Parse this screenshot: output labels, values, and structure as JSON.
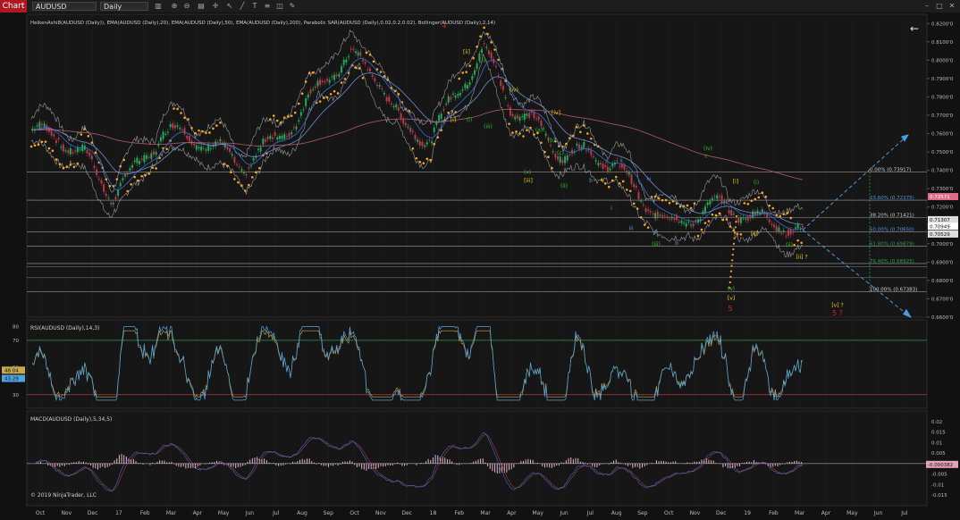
{
  "toolbar": {
    "tab_label": "Chart",
    "instrument": "AUDUSD",
    "interval": "Daily",
    "window_buttons": [
      "–",
      "□",
      "✕"
    ]
  },
  "colors": {
    "background": "#111111",
    "candle_up": "#26a65b",
    "candle_down": "#b33a4a",
    "sar": "#f5a623",
    "ema20": "#3a6fcf",
    "ema200": "#b05a6a",
    "bollinger": "#cfcfcf",
    "rsi": "#4fa3e0",
    "rsi_signal": "#c8a84b",
    "macd_hist": "#e8b6c8",
    "wave_green": "#2dc52d",
    "wave_yellow": "#e6d200",
    "wave_red": "#e02020",
    "fib": "#4a9de0",
    "fib_green": "#2f9a4a"
  },
  "price_panel": {
    "indicators_label": "HeikenAshi8(AUDUSD (Daily)), EMA(AUDUSD (Daily),20), EMA(AUDUSD (Daily),50), EMA(AUDUSD (Daily),200), Parabolic SAR(AUDUSD (Daily),0.02,0.2,0.02), Bollinger(AUDUSD (Daily),2,14)",
    "fib_levels": [
      {
        "label": "0.00% (0.73917)",
        "color": "#cfcfcf"
      },
      {
        "label": "23.60% (0.72375)",
        "color": "#4a9de0"
      },
      {
        "label": "38.20% (0.71421)",
        "color": "#cfcfcf"
      },
      {
        "label": "50.00% (0.70650)",
        "color": "#4a9de0"
      },
      {
        "label": "61.80% (0.69879)",
        "color": "#2f9a4a"
      },
      {
        "label": "76.40% (0.68925)",
        "color": "#2f9a4a"
      },
      {
        "label": "100.00% (0.67383)",
        "color": "#cfcfcf"
      }
    ],
    "price_badges": [
      {
        "label": "0.72571",
        "bg": "#e06a8a",
        "fg": "#fff"
      },
      {
        "label": "0.71307",
        "bg": "#dddddd",
        "fg": "#111"
      },
      {
        "label": "0.70949",
        "bg": "#ffffff",
        "fg": "#111"
      },
      {
        "label": "0.70529",
        "bg": "#dddddd",
        "fg": "#111"
      }
    ],
    "wave_labels": [
      {
        "text": "4",
        "color": "#e02020"
      },
      {
        "text": "[ii]",
        "color": "#e6d200"
      },
      {
        "text": "(ii)",
        "color": "#2dc52d"
      },
      {
        "text": "[i]",
        "color": "#e6d200"
      },
      {
        "text": "(i)",
        "color": "#2dc52d"
      },
      {
        "text": "(iii)",
        "color": "#2dc52d"
      },
      {
        "text": "(iv)",
        "color": "#e6d200"
      },
      {
        "text": "[iv]",
        "color": "#e6d200"
      },
      {
        "text": "(a)",
        "color": "#2dc52d"
      },
      {
        "text": "(b)",
        "color": "#2dc52d"
      },
      {
        "text": "(c)",
        "color": "#2dc52d"
      },
      {
        "text": "(v)",
        "color": "#2dc52d"
      },
      {
        "text": "[iii]",
        "color": "#e6d200"
      },
      {
        "text": "(ii)",
        "color": "#2dc52d"
      },
      {
        "text": "a",
        "color": "#4a9de0"
      },
      {
        "text": "b",
        "color": "#4a9de0"
      },
      {
        "text": "c",
        "color": "#4a9de0"
      },
      {
        "text": "i",
        "color": "#4a9de0"
      },
      {
        "text": "ii",
        "color": "#4a9de0"
      },
      {
        "text": "iii",
        "color": "#4a9de0"
      },
      {
        "text": "iv",
        "color": "#4a9de0"
      },
      {
        "text": "v",
        "color": "#4a9de0"
      },
      {
        "text": "(iii)",
        "color": "#2dc52d"
      },
      {
        "text": "(iv)",
        "color": "#2dc52d"
      },
      {
        "text": "c",
        "color": "#2dc52d"
      },
      {
        "text": "b",
        "color": "#4a9de0"
      },
      {
        "text": "(v)",
        "color": "#2dc52d"
      },
      {
        "text": "[v]",
        "color": "#e6d200"
      },
      {
        "text": "5",
        "color": "#e02020"
      },
      {
        "text": "[i]",
        "color": "#e6d200"
      },
      {
        "text": "(i)",
        "color": "#2dc52d"
      },
      {
        "text": "[ii]",
        "color": "#e6d200"
      },
      {
        "text": "(ii)",
        "color": "#2dc52d"
      },
      {
        "text": "[ii] ?",
        "color": "#e6d200"
      },
      {
        "text": "[v] ?",
        "color": "#e6d200"
      },
      {
        "text": "5 ?",
        "color": "#e02020"
      }
    ]
  },
  "rsi_panel": {
    "label": "RSI(AUDUSD (Daily),14,3)",
    "ticks": [
      "80",
      "70",
      "50",
      "30"
    ],
    "badges": [
      "48.04",
      "43.29"
    ]
  },
  "macd_panel": {
    "label": "MACD(AUDUSD (Daily),5,34,5)",
    "ticks": [
      "0.02",
      "0.015",
      "0.01",
      "0.005",
      "0",
      "-0.005",
      "-0.01",
      "-0.015"
    ],
    "badge": "-0.000382",
    "copyright": "© 2019 NinjaTrader, LLC"
  },
  "x_axis": [
    "Oct",
    "Nov",
    "Dec",
    "17",
    "Feb",
    "Mar",
    "Apr",
    "May",
    "Jun",
    "Jul",
    "Aug",
    "Sep",
    "Oct",
    "Nov",
    "Dec",
    "18",
    "Feb",
    "Mar",
    "Apr",
    "May",
    "Jun",
    "Jul",
    "Aug",
    "Sep",
    "Oct",
    "Nov",
    "Dec",
    "19",
    "Feb",
    "Mar",
    "Apr",
    "May",
    "Jun",
    "Jul",
    "Aug"
  ],
  "chart_data": {
    "type": "line",
    "instrument": "AUDUSD",
    "interval": "Daily",
    "y_axis_ticks": [
      "0.8200'0",
      "0.8100'0",
      "0.8000'0",
      "0.7900'0",
      "0.7800'0",
      "0.7700'0",
      "0.7600'0",
      "0.7500'0",
      "0.7400'0",
      "0.7300'0",
      "0.7200'0",
      "0.7100'0",
      "0.7000'0",
      "0.6900'0",
      "0.6800'0",
      "0.6700'0",
      "0.6600'0"
    ],
    "ylim": [
      0.66,
      0.825
    ],
    "x": [
      "Oct",
      "Nov",
      "Dec",
      "17",
      "Feb",
      "Mar",
      "Apr",
      "May",
      "Jun",
      "Jul",
      "Aug",
      "Sep",
      "Oct",
      "Nov",
      "Dec",
      "18",
      "Feb",
      "Mar",
      "Apr",
      "May",
      "Jun",
      "Jul",
      "Aug",
      "Sep",
      "Oct",
      "Nov",
      "Dec",
      "19",
      "Feb",
      "Mar"
    ],
    "series": [
      {
        "values": [
          0.762,
          0.758,
          0.748,
          0.726,
          0.742,
          0.762,
          0.758,
          0.752,
          0.742,
          0.755,
          0.768,
          0.79,
          0.802,
          0.792,
          0.762,
          0.758,
          0.782,
          0.806,
          0.776,
          0.764,
          0.748,
          0.75,
          0.742,
          0.724,
          0.71,
          0.716,
          0.722,
          0.714,
          0.712,
          0.705
        ]
      }
    ],
    "fibonacci": [
      {
        "level": "0.00%",
        "price": 0.73917
      },
      {
        "level": "23.60%",
        "price": 0.72375
      },
      {
        "level": "38.20%",
        "price": 0.71421
      },
      {
        "level": "50.00%",
        "price": 0.7065
      },
      {
        "level": "61.80%",
        "price": 0.69879
      },
      {
        "level": "76.40%",
        "price": 0.68925
      },
      {
        "level": "100.00%",
        "price": 0.67383
      }
    ],
    "last_price": 0.70949,
    "rsi": {
      "ylim": [
        20,
        85
      ],
      "ticks": [
        80,
        70,
        50,
        30
      ],
      "last": 48.04,
      "signal": 43.29
    },
    "macd": {
      "ylim": [
        -0.02,
        0.025
      ],
      "last": -0.000382
    }
  }
}
